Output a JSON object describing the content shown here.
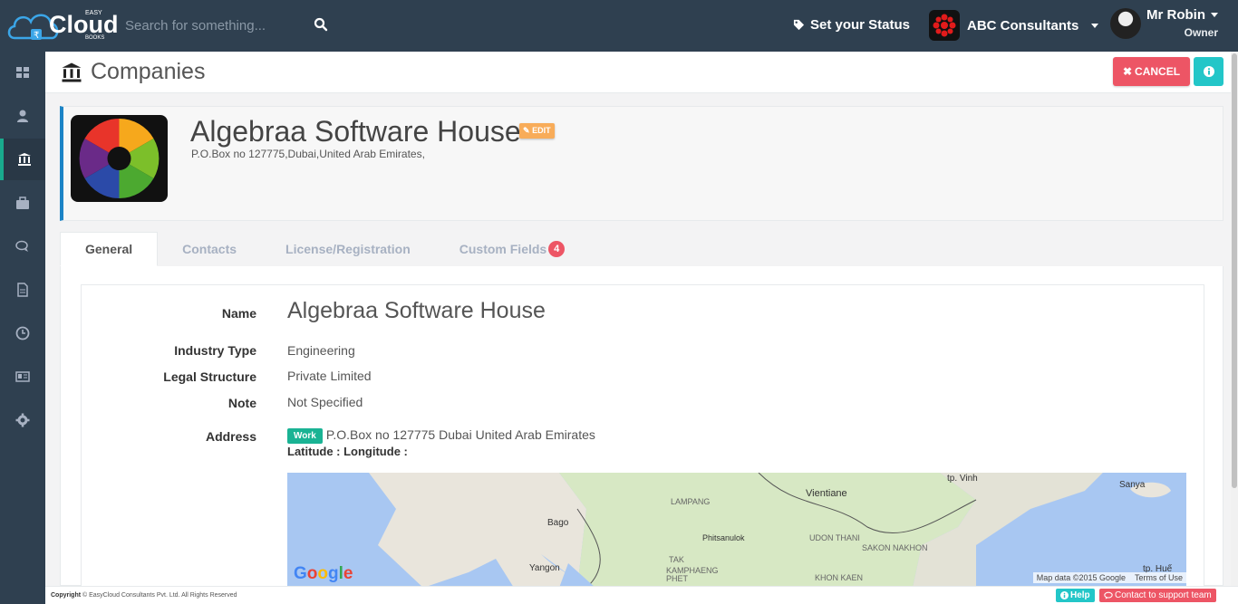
{
  "app": {
    "logo_text": "Cloud",
    "logo_super": "EASY",
    "logo_sub": "BOOKS"
  },
  "topbar": {
    "search_placeholder": "Search for something...",
    "status_label": "Set your Status",
    "company_name": "ABC Consultants",
    "user_name": "Mr Robin",
    "user_role": "Owner"
  },
  "sidebar": {
    "items": [
      {
        "icon": "dashboard-icon",
        "active": false
      },
      {
        "icon": "user-icon",
        "active": false
      },
      {
        "icon": "bank-icon",
        "active": true
      },
      {
        "icon": "briefcase-icon",
        "active": false
      },
      {
        "icon": "comments-icon",
        "active": false
      },
      {
        "icon": "document-icon",
        "active": false
      },
      {
        "icon": "clock-icon",
        "active": false
      },
      {
        "icon": "id-card-icon",
        "active": false
      },
      {
        "icon": "gear-icon",
        "active": false
      }
    ]
  },
  "page": {
    "title": "Companies",
    "cancel_label": "CANCEL"
  },
  "company": {
    "name": "Algebraa Software House",
    "address": "P.O.Box no 127775,Dubai,United Arab Emirates,",
    "edit_label": "EDIT"
  },
  "tabs": [
    {
      "label": "General",
      "active": true
    },
    {
      "label": "Contacts",
      "active": false
    },
    {
      "label": "License/Registration",
      "active": false
    },
    {
      "label": "Custom Fields",
      "active": false,
      "count": "4"
    }
  ],
  "details": {
    "name_label": "Name",
    "name_value": "Algebraa Software House",
    "industry_label": "Industry Type",
    "industry_value": "Engineering",
    "legal_label": "Legal Structure",
    "legal_value": "Private Limited",
    "note_label": "Note",
    "note_value": "Not Specified",
    "address_label": "Address",
    "address_tag": "Work",
    "address_value": "P.O.Box no 127775 Dubai United Arab Emirates",
    "latlong_label": "Latitude : Longitude :"
  },
  "map": {
    "labels": [
      "tp. Vinh",
      "Sanya",
      "Vientiane",
      "LAMPANG",
      "Bago",
      "Phitsanulok",
      "UDON THANI",
      "SAKON NAKHON",
      "TAK",
      "KAMPHAENG PHET",
      "KHON KAEN",
      "Yangon",
      "tp. Huế"
    ],
    "google_text": "Google",
    "attribution": "Map data ©2015 Google",
    "terms": "Terms of Use"
  },
  "footer": {
    "copyright_bold": "Copyright",
    "copyright_text": "© EasyCloud Consultants Pvt. Ltd. All Rights Reserved",
    "help_label": "Help",
    "support_label": "Contact to support team"
  },
  "colors": {
    "nav_bg": "#2f4050",
    "accent_green": "#1ab394",
    "danger": "#ed5565",
    "info": "#23c6c8",
    "warning": "#f8ac59"
  }
}
